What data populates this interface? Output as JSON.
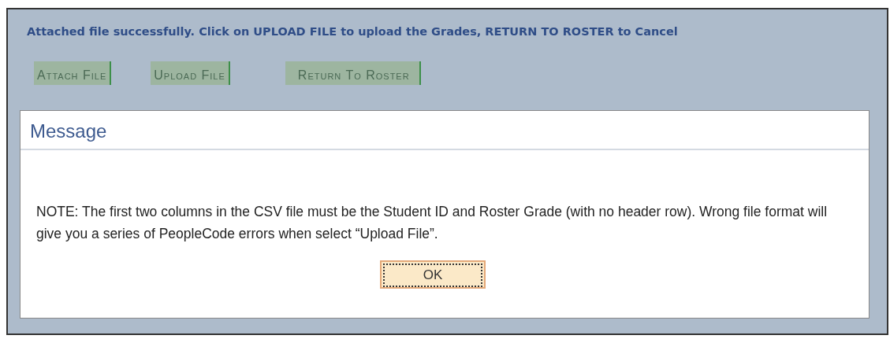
{
  "page": {
    "message": "Attached file successfully. Click on UPLOAD FILE to upload the Grades, RETURN TO ROSTER to Cancel",
    "buttons": [
      "Attach File",
      "Upload File",
      "Return To Roster"
    ]
  },
  "dialog": {
    "title": "Message",
    "text": "NOTE:  The first two columns in the CSV file must be the Student ID and Roster Grade (with no header row).  Wrong file format will give you a series of PeopleCode errors when select “Upload File”.",
    "buttons": [
      "OK"
    ]
  }
}
